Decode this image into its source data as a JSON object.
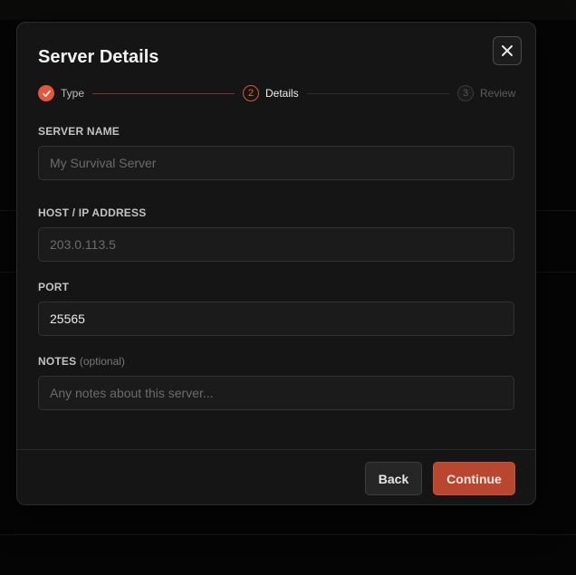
{
  "modal": {
    "title": "Server Details"
  },
  "stepper": {
    "steps": [
      {
        "number": "1",
        "label": "Type",
        "state": "complete"
      },
      {
        "number": "2",
        "label": "Details",
        "state": "active"
      },
      {
        "number": "3",
        "label": "Review",
        "state": "upcoming"
      }
    ]
  },
  "form": {
    "server_name": {
      "label": "SERVER NAME",
      "value": "",
      "placeholder": "My Survival Server"
    },
    "host": {
      "label": "HOST / IP ADDRESS",
      "value": "",
      "placeholder": "203.0.113.5"
    },
    "port": {
      "label": "PORT",
      "value": "25565",
      "placeholder": ""
    },
    "notes": {
      "label": "NOTES",
      "optional_hint": "(optional)",
      "value": "",
      "placeholder": "Any notes about this server..."
    }
  },
  "footer": {
    "back_label": "Back",
    "continue_label": "Continue"
  },
  "colors": {
    "accent": "#e4573a",
    "continue_bg": "#b94730",
    "modal_bg": "#151515",
    "page_bg": "#050605"
  },
  "icons": {
    "close": "close-icon",
    "step_complete": "check-icon"
  }
}
